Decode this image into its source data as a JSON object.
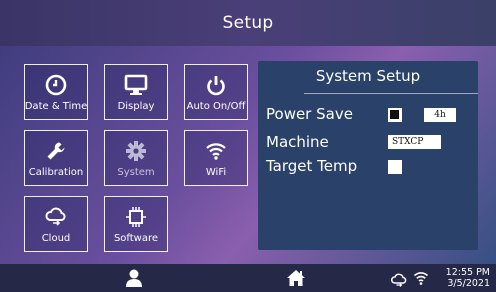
{
  "header": {
    "title": "Setup"
  },
  "tiles": [
    {
      "label": "Date & Time",
      "icon": "clock-icon"
    },
    {
      "label": "Display",
      "icon": "monitor-icon"
    },
    {
      "label": "Auto On/Off",
      "icon": "power-icon"
    },
    {
      "label": "Calibration",
      "icon": "wrench-icon"
    },
    {
      "label": "System",
      "icon": "gear-icon",
      "state": "selected-dimmed"
    },
    {
      "label": "WiFi",
      "icon": "wifi-icon"
    },
    {
      "label": "Cloud",
      "icon": "cloud-sync-icon"
    },
    {
      "label": "Software",
      "icon": "chip-icon"
    }
  ],
  "panel": {
    "title": "System Setup",
    "power_save": {
      "label": "Power Save",
      "checked": true,
      "value": "4h"
    },
    "machine": {
      "label": "Machine",
      "value": "STXCP"
    },
    "target_temp": {
      "label": "Target Temp",
      "checked": false
    }
  },
  "footer": {
    "time": "12:55 PM",
    "date": "3/5/2021",
    "icons": [
      "user-icon",
      "home-icon",
      "cloud-sync-icon",
      "wifi-icon"
    ]
  },
  "colors": {
    "header_bg": "#3a3566",
    "panel_bg": "#2a416a",
    "footer_bg": "#252947",
    "tile_border": "#ffffff"
  }
}
